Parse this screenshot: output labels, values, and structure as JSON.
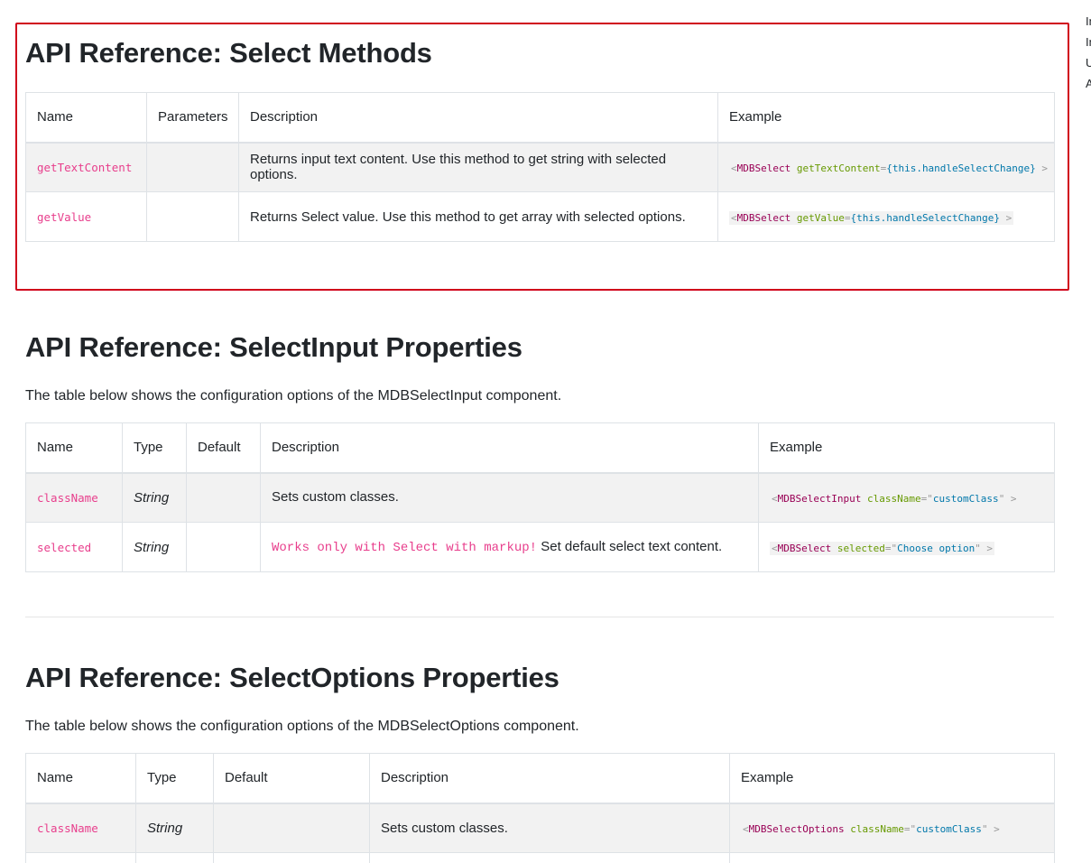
{
  "sections": {
    "methods": {
      "title": "API Reference: Select Methods",
      "headers": [
        "Name",
        "Parameters",
        "Description",
        "Example"
      ],
      "rows": [
        {
          "name": "getTextContent",
          "params": "",
          "desc": "Returns input text content. Use this method to get string with selected options.",
          "code": {
            "lt": "<",
            "tag": "MDBSelect",
            "attr": "getTextContent",
            "eq": "=",
            "val": "{this.handleSelectChange}",
            "end": " >"
          }
        },
        {
          "name": "getValue",
          "params": "",
          "desc": "Returns Select value. Use this method to get array with selected options.",
          "code": {
            "lt": "<",
            "tag": "MDBSelect",
            "attr": "getValue",
            "eq": "=",
            "val": "{this.handleSelectChange}",
            "end": " >"
          }
        }
      ]
    },
    "input_props": {
      "title": "API Reference: SelectInput Properties",
      "desc": "The table below shows the configuration options of the MDBSelectInput component.",
      "headers": [
        "Name",
        "Type",
        "Default",
        "Description",
        "Example"
      ],
      "rows": [
        {
          "name": "className",
          "type": "String",
          "default": "",
          "desc_warn": "",
          "desc": "Sets custom classes.",
          "code": {
            "lt": "<",
            "tag": "MDBSelectInput",
            "attr": "className",
            "eq": "=",
            "q1": "\"",
            "val": "customClass",
            "q2": "\"",
            "end": " >"
          }
        },
        {
          "name": "selected",
          "type": "String",
          "default": "",
          "desc_warn": "Works only with Select with markup!",
          "desc": " Set default select text content.",
          "code": {
            "lt": "<",
            "tag": "MDBSelect",
            "attr": "selected",
            "eq": "=",
            "q1": "\"",
            "val": "Choose option",
            "q2": "\"",
            "end": " >"
          }
        }
      ]
    },
    "options_props": {
      "title": "API Reference: SelectOptions Properties",
      "desc": "The table below shows the configuration options of the MDBSelectOptions component.",
      "headers": [
        "Name",
        "Type",
        "Default",
        "Description",
        "Example"
      ],
      "rows": [
        {
          "name": "className",
          "type": "String",
          "default": "",
          "desc": "Sets custom classes.",
          "code": {
            "lt": "<",
            "tag": "MDBSelectOptions",
            "attr": "className",
            "eq": "=",
            "q1": "\"",
            "val": "customClass",
            "q2": "\"",
            "end": " >"
          }
        }
      ]
    }
  },
  "sidebar_clipped": [
    "In",
    "In",
    "U",
    "A"
  ],
  "colors": {
    "highlight_border": "#d0021b",
    "prop_name": "#e83e8c",
    "row_shade": "#f2f2f2"
  }
}
